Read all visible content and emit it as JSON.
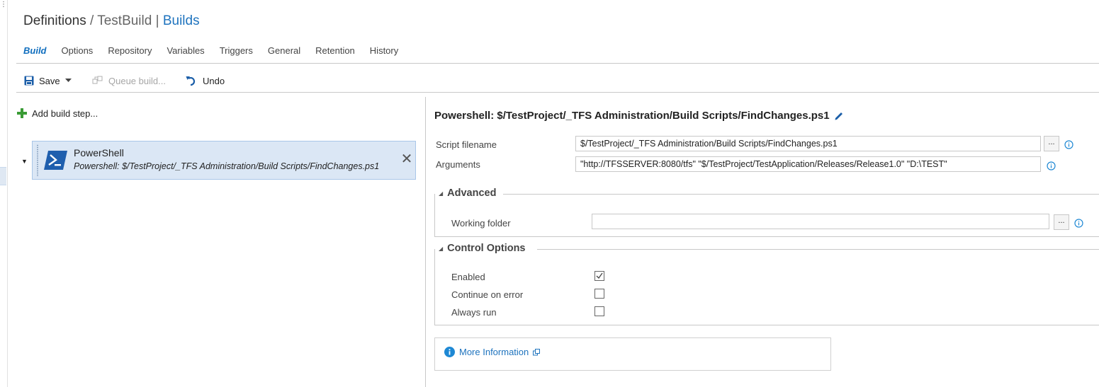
{
  "header": {
    "crumb1": "Definitions",
    "separator": "/",
    "crumb2": "TestBuild",
    "pipe": "|",
    "link": "Builds"
  },
  "tabs": [
    {
      "label": "Build",
      "active": true
    },
    {
      "label": "Options"
    },
    {
      "label": "Repository"
    },
    {
      "label": "Variables"
    },
    {
      "label": "Triggers"
    },
    {
      "label": "General"
    },
    {
      "label": "Retention"
    },
    {
      "label": "History"
    }
  ],
  "toolbar": {
    "save_label": "Save",
    "queue_label": "Queue build...",
    "undo_label": "Undo"
  },
  "left_pane": {
    "add_step_label": "Add build step...",
    "steps": [
      {
        "name": "PowerShell",
        "description": "Powershell: $/TestProject/_TFS Administration/Build Scripts/FindChanges.ps1",
        "icon": "powershell-icon",
        "selected": true
      }
    ]
  },
  "task": {
    "title": "Powershell: $/TestProject/_TFS Administration/Build Scripts/FindChanges.ps1",
    "script_filename_label": "Script filename",
    "script_filename_value": "$/TestProject/_TFS Administration/Build Scripts/FindChanges.ps1",
    "arguments_label": "Arguments",
    "arguments_value": "\"http://TFSSERVER:8080/tfs\" \"$/TestProject/TestApplication/Releases/Release1.0\" \"D:\\TEST\"",
    "browse_label": "...",
    "advanced": {
      "title": "Advanced",
      "working_folder_label": "Working folder",
      "working_folder_value": ""
    },
    "control_options": {
      "title": "Control Options",
      "enabled_label": "Enabled",
      "enabled": true,
      "continue_on_error_label": "Continue on error",
      "continue_on_error": false,
      "always_run_label": "Always run",
      "always_run": false
    },
    "more_information_label": "More Information"
  },
  "colors": {
    "accent": "#106ebe",
    "link": "#1e73be",
    "selected_bg": "#dbe7f5",
    "add_green": "#3a9b35"
  }
}
